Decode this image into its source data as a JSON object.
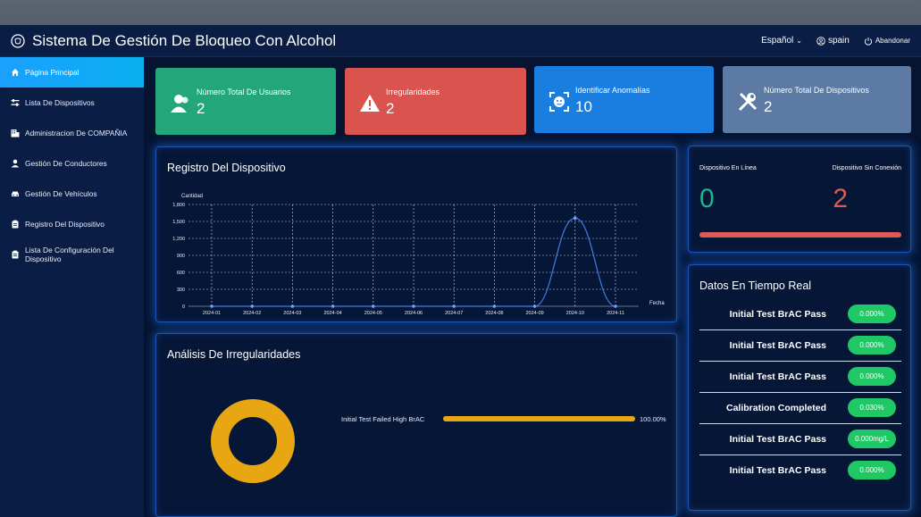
{
  "app": {
    "title": "Sistema De Gestión De Bloqueo Con Alcohol",
    "language": "Español",
    "user": "spain",
    "logout": "Abandonar"
  },
  "sidebar": {
    "items": [
      {
        "label": "Página Principal",
        "icon": "home-icon",
        "active": true
      },
      {
        "label": "Lista De Dispositivos",
        "icon": "sliders-icon"
      },
      {
        "label": "Administracion De COMPAÑIA",
        "icon": "company-icon"
      },
      {
        "label": "Gestión De Conductores",
        "icon": "user-icon"
      },
      {
        "label": "Gestión De Vehículos",
        "icon": "car-icon"
      },
      {
        "label": "Registro Del Dispositivo",
        "icon": "clipboard-icon"
      },
      {
        "label": "Lista De Configuración Del Dispositivo",
        "icon": "clipboard-icon"
      }
    ]
  },
  "stats": [
    {
      "label": "Número Total De Usuarios",
      "value": "2",
      "color": "#23a679",
      "icon": "users-icon"
    },
    {
      "label": "Irregularidades",
      "value": "2",
      "color": "#d9534f",
      "icon": "warning-icon"
    },
    {
      "label": "Identificar Anomalías",
      "value": "10",
      "color": "#1a7de0",
      "icon": "face-scan-icon"
    },
    {
      "label": "Número Total De Dispositivos",
      "value": "2",
      "color": "#5c7aa3",
      "icon": "tools-icon"
    }
  ],
  "status": {
    "online_label": "Dispositivo En Línea",
    "offline_label": "Dispositivo Sin Conexión",
    "online_value": "0",
    "offline_value": "2",
    "online_color": "#20b38a",
    "offline_color": "#e05a55"
  },
  "registro": {
    "title": "Registro Del Dispositivo"
  },
  "chart_data": {
    "type": "line",
    "ylabel": "Cantidad",
    "xlabel": "Fecha",
    "x": [
      "2024-01",
      "2024-02",
      "2024-03",
      "2024-04",
      "2024-05",
      "2024-06",
      "2024-07",
      "2024-08",
      "2024-09",
      "2024-10",
      "2024-11"
    ],
    "values": [
      0,
      0,
      0,
      0,
      0,
      0,
      0,
      0,
      0,
      1560,
      0
    ],
    "yticks": [
      0,
      300,
      600,
      900,
      1200,
      1500,
      1800
    ],
    "ytick_labels": [
      "0",
      "300",
      "600",
      "900",
      "1,200",
      "1,500",
      "1,800"
    ],
    "ylim": [
      0,
      1800
    ],
    "grid": true,
    "color": "#3f7fe0"
  },
  "irregular": {
    "title": "Análisis De Irregularidades",
    "bar_label": "Initial Test Failed High BrAC",
    "bar_percent_text": "100.00%",
    "bar_fraction": 1.0,
    "color": "#e8a712"
  },
  "realtime": {
    "title": "Datos En Tiempo Real",
    "rows": [
      {
        "text": "Initial Test BrAC Pass",
        "value": "0.000%"
      },
      {
        "text": "Initial Test BrAC Pass",
        "value": "0.000%"
      },
      {
        "text": "Initial Test BrAC Pass",
        "value": "0.000%"
      },
      {
        "text": "Calibration Completed",
        "value": "0.030%"
      },
      {
        "text": "Initial Test BrAC Pass",
        "value": "0.000mg/L"
      },
      {
        "text": "Initial Test BrAC Pass",
        "value": "0.000%"
      }
    ]
  }
}
